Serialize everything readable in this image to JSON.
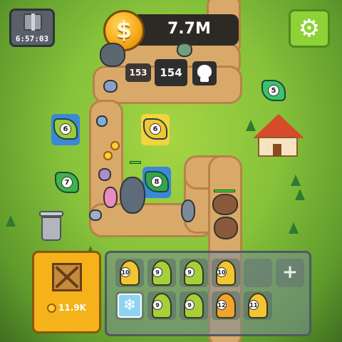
{
  "hud": {
    "gift_timer": "6:57:03",
    "currency": "7.7M",
    "coin_symbol": "$",
    "settings_symbol": "⚙"
  },
  "wave": {
    "previous": "153",
    "current": "154"
  },
  "field_towers": [
    {
      "level": "6",
      "color": "#9ccc3a",
      "slot_color": "#3a88d6"
    },
    {
      "level": "6",
      "color": "#f2c534",
      "slot_color": "#f4d43c"
    },
    {
      "level": "7",
      "color": "#3cb44a",
      "slot_color": "rgba(0,0,0,0)"
    },
    {
      "level": "8",
      "color": "#2fa84a",
      "slot_color": "#3a88d6"
    },
    {
      "level": "5",
      "color": "#3cc36a",
      "slot_color": "rgba(0,0,0,0)"
    }
  ],
  "shop": {
    "price": "11.9K"
  },
  "inventory": {
    "plus_symbol": "+",
    "snow_symbol": "❄",
    "items": [
      {
        "level": "10",
        "color": "#f2c534"
      },
      {
        "level": "9",
        "color": "#a6cf3c"
      },
      {
        "level": "9",
        "color": "#a6cf3c"
      },
      {
        "level": "10",
        "color": "#f2c534"
      },
      {
        "level": "9",
        "color": "#a6cf3c"
      },
      {
        "level": "9",
        "color": "#a6cf3c"
      },
      {
        "level": "12",
        "color": "#f0a530"
      },
      {
        "level": "11",
        "color": "#f2c534"
      }
    ]
  }
}
